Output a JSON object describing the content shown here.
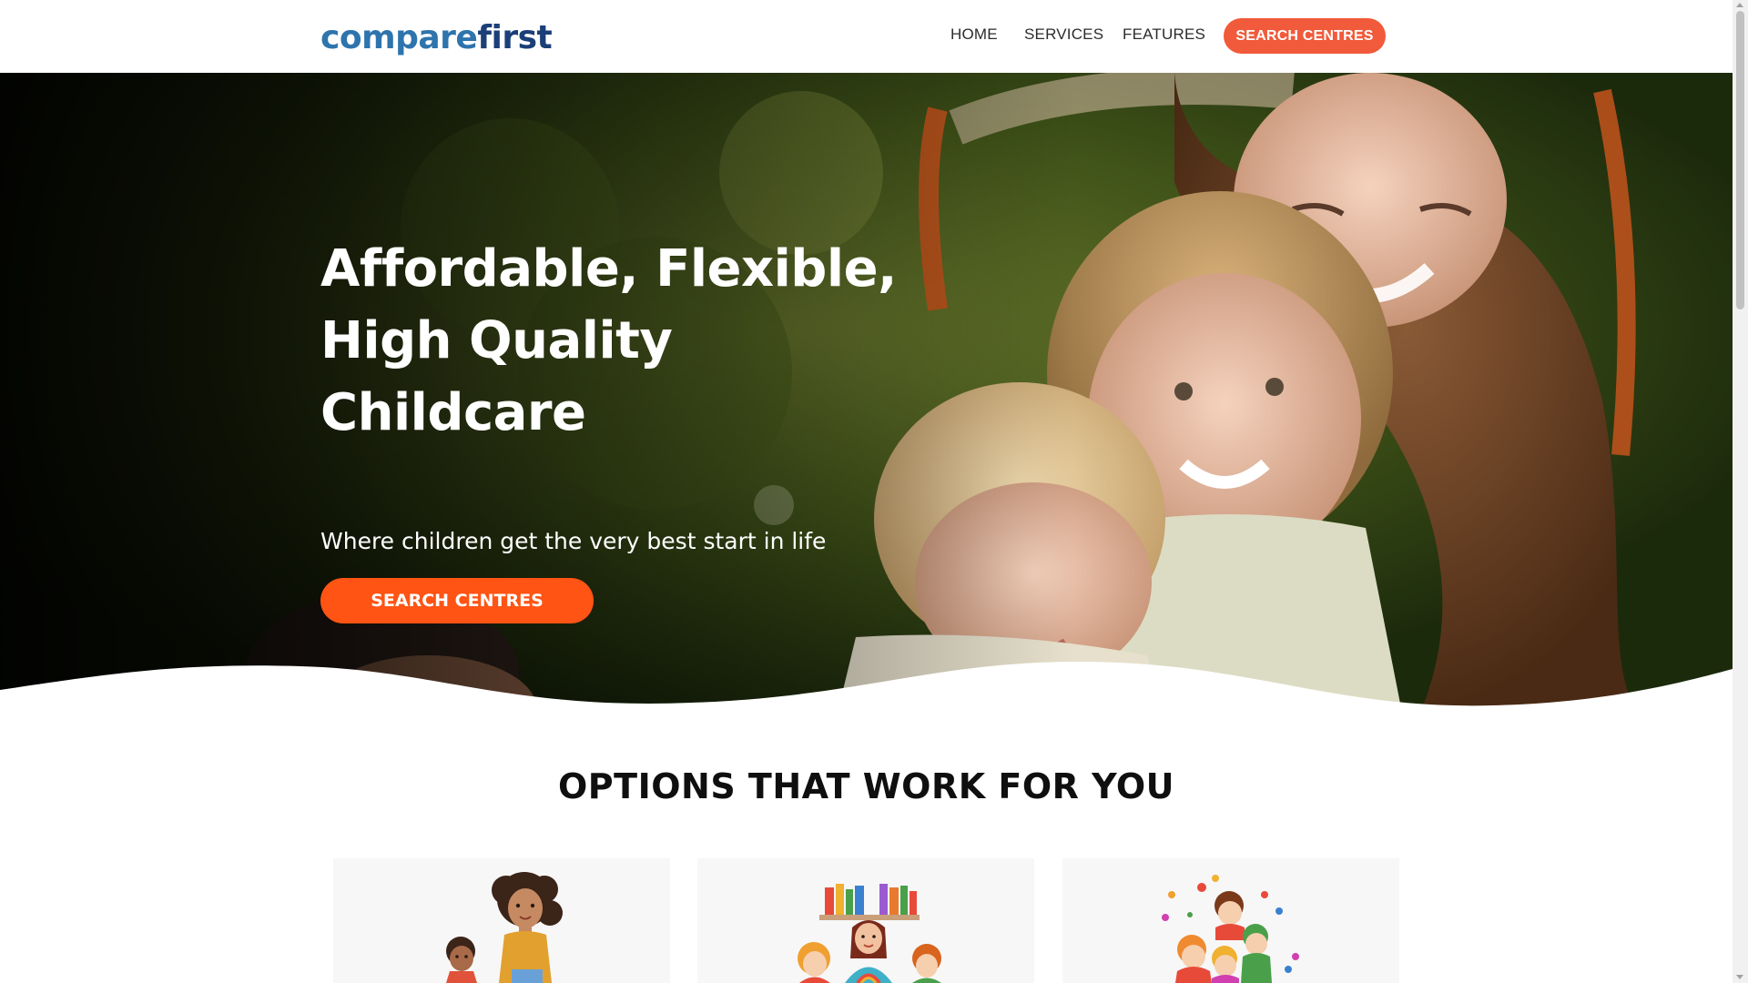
{
  "brand": {
    "logo_part1": "compare",
    "logo_part2": "first"
  },
  "nav": {
    "links": [
      "HOME",
      "SERVICES",
      "FEATURES"
    ],
    "cta_label": "SEARCH CENTRES",
    "accent_color": "#f15a3a"
  },
  "hero": {
    "title_lines": [
      "Affordable, Flexible,",
      "High Quality",
      "Childcare"
    ],
    "subtitle": "Where children get the very best start in life",
    "cta_label": "SEARCH CENTRES",
    "cta_color": "#ff5414"
  },
  "options": {
    "title": "OPTIONS THAT WORK FOR YOU",
    "cards": [
      {
        "icon": "parent-with-child-illustration"
      },
      {
        "icon": "teacher-with-children-bookshelf-illustration"
      },
      {
        "icon": "children-playing-balls-illustration"
      }
    ]
  }
}
